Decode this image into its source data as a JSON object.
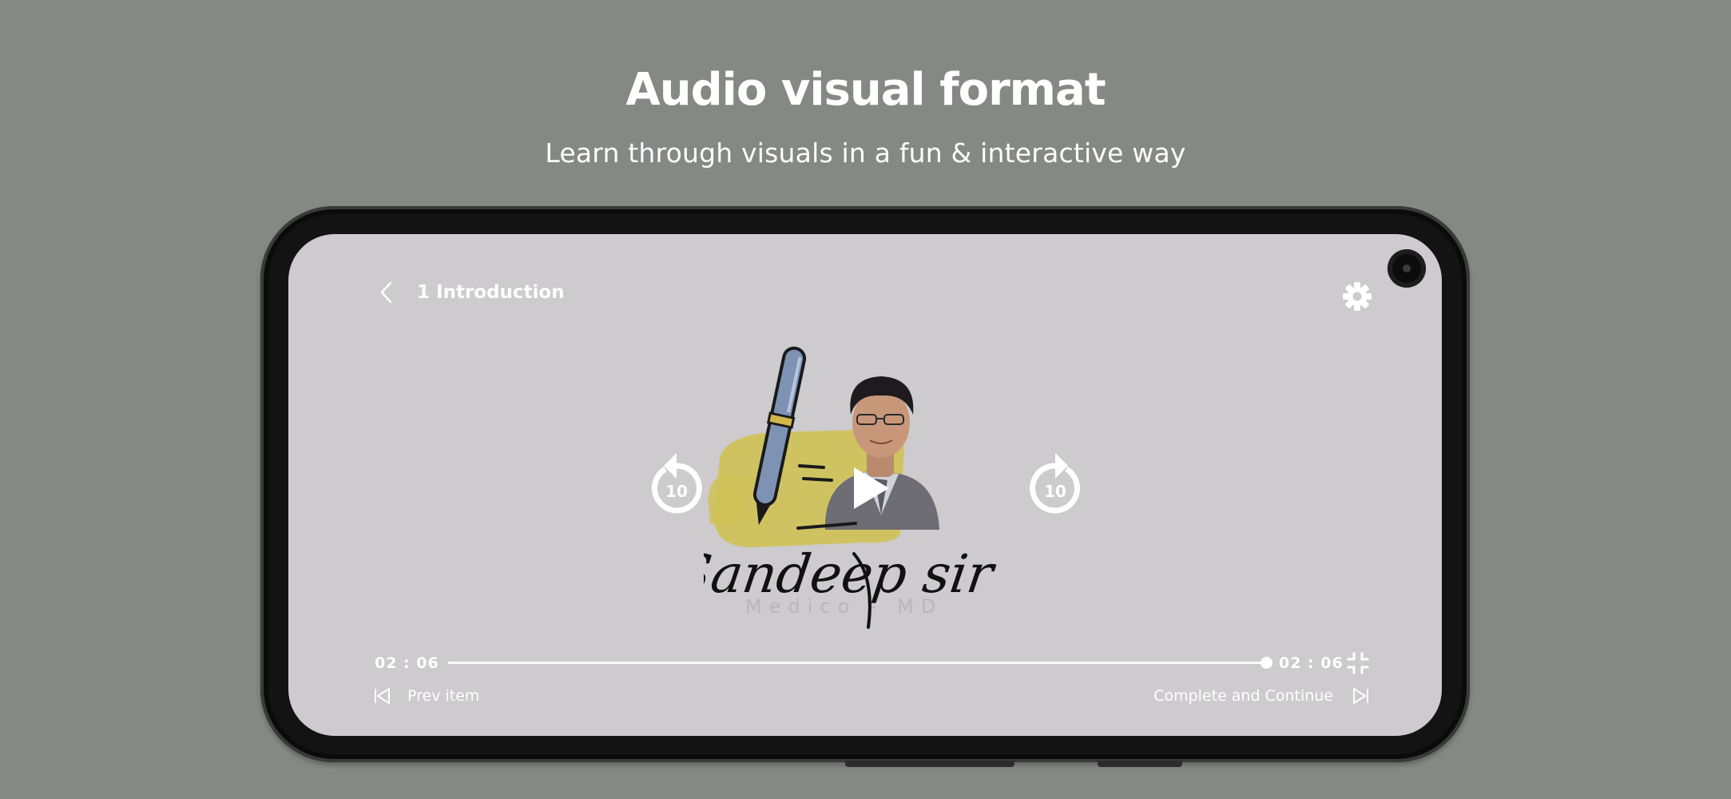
{
  "hero": {
    "title": "Audio visual format",
    "subtitle": "Learn through visuals in a fun & interactive way"
  },
  "player": {
    "lesson_title": "1 Introduction",
    "artwork": {
      "name_text": "Sandeep sir",
      "tagline_text": "Medico - MD"
    },
    "skip_seconds_back": "10",
    "skip_seconds_forward": "10",
    "current_time": "02 : 06",
    "total_time": "02 : 06",
    "progress_fraction": 1.0,
    "prev_label": "Prev item",
    "next_label": "Complete and Continue"
  },
  "colors": {
    "page_background": "#848983",
    "screen_background": "#cdcbcd",
    "phone_body": "#131313",
    "accent_yellow": "#cfc258",
    "pen_blue": "#7e93b4"
  },
  "icons": {
    "back": "chevron-left-icon",
    "settings": "gear-icon",
    "rewind": "rewind-10-icon",
    "play": "play-icon",
    "forward": "forward-10-icon",
    "exit_fullscreen": "exit-fullscreen-icon",
    "prev": "skip-previous-icon",
    "next": "skip-next-icon"
  }
}
